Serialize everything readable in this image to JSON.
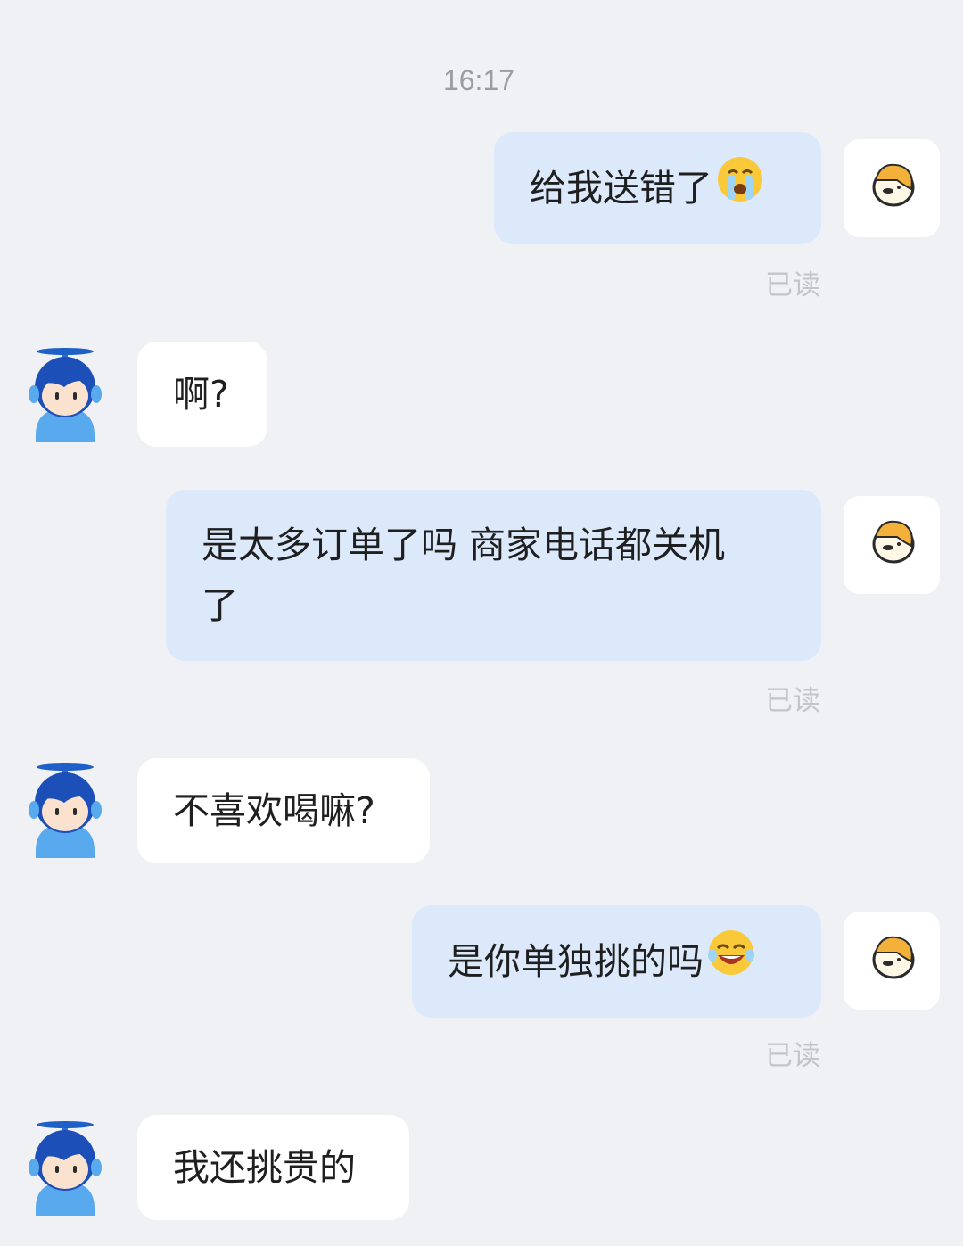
{
  "time": "16:17",
  "read_label": "已读",
  "messages": [
    {
      "side": "out",
      "text": "给我送错了",
      "emoji": "crying-face-emoji"
    },
    {
      "side": "in",
      "text": "啊?"
    },
    {
      "side": "out",
      "line1": "是太多订单了吗 商家电话都关机",
      "line2": "了"
    },
    {
      "side": "in",
      "text": "不喜欢喝嘛?"
    },
    {
      "side": "out",
      "text": "是你单独挑的吗",
      "emoji": "laughing-tears-face-emoji"
    },
    {
      "side": "in",
      "text": "我还挑贵的"
    }
  ],
  "colors": {
    "background": "#f0f1f5",
    "outgoing_bubble": "#dce9fb",
    "incoming_bubble": "#ffffff",
    "read_text": "#c3c5cb",
    "timestamp_text": "#9a9ca2"
  }
}
